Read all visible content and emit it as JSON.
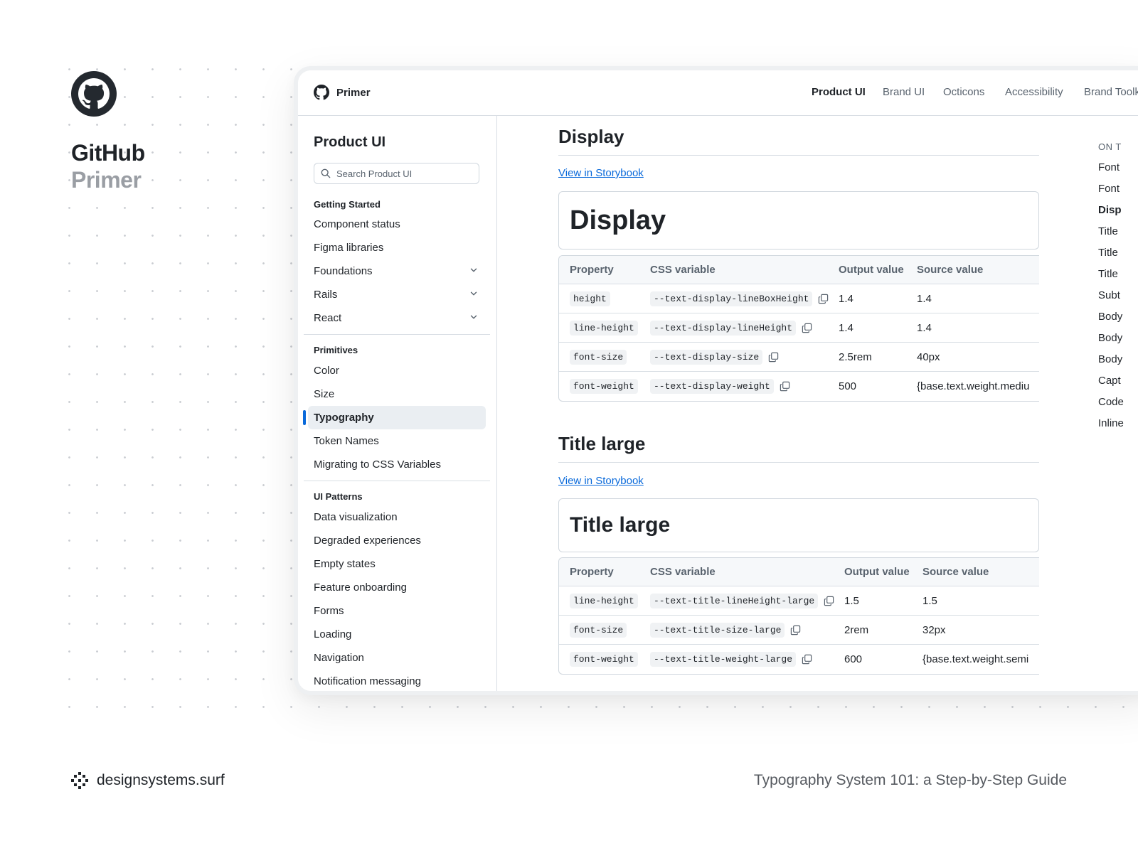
{
  "brand": {
    "title": "GitHub",
    "subtitle": "Primer"
  },
  "footer": {
    "site": "designsystems.surf",
    "guide": "Typography System 101: a Step-by-Step Guide"
  },
  "topbar": {
    "app_name": "Primer",
    "nav": [
      "Product UI",
      "Brand UI",
      "Octicons",
      "Accessibility",
      "Brand Toolk"
    ],
    "active": "Product UI"
  },
  "sidebar": {
    "title": "Product UI",
    "search_placeholder": "Search Product UI",
    "sections": [
      {
        "title": "Getting Started",
        "items": [
          "Component status",
          "Figma libraries",
          "Foundations",
          "Rails",
          "React"
        ]
      },
      {
        "title": "Primitives",
        "items": [
          "Color",
          "Size",
          "Typography",
          "Token Names",
          "Migrating to CSS Variables"
        ]
      },
      {
        "title": "UI Patterns",
        "items": [
          "Data visualization",
          "Degraded experiences",
          "Empty states",
          "Feature onboarding",
          "Forms",
          "Loading",
          "Navigation",
          "Notification messaging"
        ]
      }
    ],
    "active_item": "Typography"
  },
  "display_section": {
    "heading": "Display",
    "link": "View in Storybook",
    "preview": "Display",
    "columns": [
      "Property",
      "CSS variable",
      "Output value",
      "Source value"
    ],
    "rows": [
      {
        "property": "height",
        "variable": "--text-display-lineBoxHeight",
        "output": "1.4",
        "source": "1.4"
      },
      {
        "property": "line-height",
        "variable": "--text-display-lineHeight",
        "output": "1.4",
        "source": "1.4"
      },
      {
        "property": "font-size",
        "variable": "--text-display-size",
        "output": "2.5rem",
        "source": "40px"
      },
      {
        "property": "font-weight",
        "variable": "--text-display-weight",
        "output": "500",
        "source": "{base.text.weight.mediu"
      }
    ]
  },
  "title_large_section": {
    "heading": "Title large",
    "link": "View in Storybook",
    "preview": "Title large",
    "columns": [
      "Property",
      "CSS variable",
      "Output value",
      "Source value"
    ],
    "rows": [
      {
        "property": "line-height",
        "variable": "--text-title-lineHeight-large",
        "output": "1.5",
        "source": "1.5"
      },
      {
        "property": "font-size",
        "variable": "--text-title-size-large",
        "output": "2rem",
        "source": "32px"
      },
      {
        "property": "font-weight",
        "variable": "--text-title-weight-large",
        "output": "600",
        "source": "{base.text.weight.semi"
      }
    ]
  },
  "toc": {
    "heading": "ON T",
    "items": [
      "Font",
      "Font",
      "Disp",
      "Title",
      "Title",
      "Title",
      "Subt",
      "Body",
      "Body",
      "Body",
      "Capt",
      "Code",
      "Inline"
    ],
    "current": "Disp"
  },
  "colors": {
    "accent": "#0969da",
    "text": "#1f2328",
    "muted": "#59636e",
    "border": "#d0d7de"
  },
  "icons": {
    "brand": "github-mark-icon",
    "search": "search-icon",
    "chevron": "chevron-down-icon",
    "copy": "copy-icon",
    "site": "designsystems-logo-icon"
  }
}
